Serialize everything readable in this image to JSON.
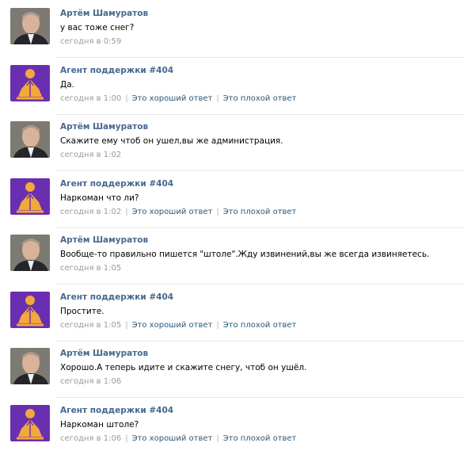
{
  "thread": {
    "messages": [
      {
        "role": "user",
        "author": "Артём Шамуратов",
        "text": "у вас тоже снег?",
        "time": "сегодня в 0:59"
      },
      {
        "role": "agent",
        "author": "Агент поддержки #404",
        "text": "Да.",
        "time": "сегодня в 1:00",
        "good": "Это хороший ответ",
        "bad": "Это плохой ответ"
      },
      {
        "role": "user",
        "author": "Артём Шамуратов",
        "text": "Скажите ему чтоб он ушел,вы же администрация.",
        "time": "сегодня в 1:02"
      },
      {
        "role": "agent",
        "author": "Агент поддержки #404",
        "text": "Наркоман что ли?",
        "time": "сегодня в 1:02",
        "good": "Это хороший ответ",
        "bad": "Это плохой ответ"
      },
      {
        "role": "user",
        "author": "Артём Шамуратов",
        "text": "Вообще-то правильно пишется \"штоле\".Жду извинений,вы же всегда извиняетесь.",
        "time": "сегодня в 1:05"
      },
      {
        "role": "agent",
        "author": "Агент поддержки #404",
        "text": "Простите.",
        "time": "сегодня в 1:05",
        "good": "Это хороший ответ",
        "bad": "Это плохой ответ"
      },
      {
        "role": "user",
        "author": "Артём Шамуратов",
        "text": "Хорошо.А теперь идите и скажите снегу, чтоб он ушёл.",
        "time": "сегодня в 1:06"
      },
      {
        "role": "agent",
        "author": "Агент поддержки #404",
        "text": "Наркоман штоле?",
        "time": "сегодня в 1:06",
        "good": "Это хороший ответ",
        "bad": "Это плохой ответ"
      }
    ]
  },
  "colors": {
    "author": "#45688e",
    "meta": "#999999",
    "vote_link": "#2b587a",
    "agent_avatar_bg": "#6a2fb0",
    "agent_avatar_figure": "#f2a93b"
  }
}
